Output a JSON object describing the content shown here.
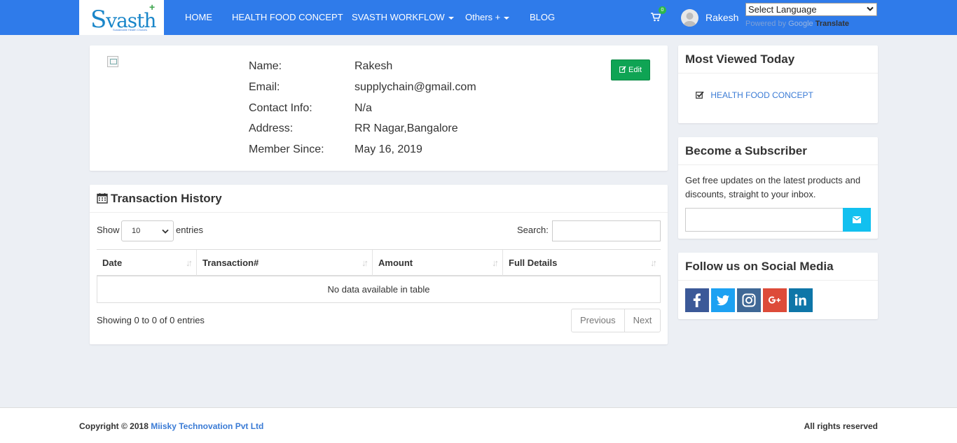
{
  "brand": {
    "logo_text": "vasth",
    "logo_initial": "S",
    "logo_plus": "+",
    "tagline": "Sustainable Health Choices"
  },
  "nav": {
    "items": [
      {
        "label": "HOME"
      },
      {
        "label": "HEALTH FOOD CONCEPT"
      },
      {
        "label": "SVASTH WORKFLOW"
      },
      {
        "label": "Others +"
      },
      {
        "label": "BLOG"
      }
    ],
    "cart_count": "0",
    "user_name": "Rakesh",
    "language_select": "Select Language",
    "powered_by": "Powered by",
    "google": "Google",
    "translate": "Translate"
  },
  "profile": {
    "edit_label": "Edit",
    "fields": [
      {
        "label": "Name:",
        "value": "Rakesh"
      },
      {
        "label": "Email:",
        "value": "supplychain@gmail.com"
      },
      {
        "label": "Contact Info:",
        "value": "N/a"
      },
      {
        "label": "Address:",
        "value": "RR Nagar,Bangalore"
      },
      {
        "label": "Member Since:",
        "value": "May 16, 2019"
      }
    ]
  },
  "transactions": {
    "title": "Transaction History",
    "show_label": "Show",
    "page_size": "10",
    "entries_label": "entries",
    "search_label": "Search:",
    "columns": [
      "Date",
      "Transaction#",
      "Amount",
      "Full Details"
    ],
    "empty_text": "No data available in table",
    "showing_text": "Showing 0 to 0 of 0 entries",
    "prev_label": "Previous",
    "next_label": "Next"
  },
  "sidebar": {
    "most_viewed_title": "Most Viewed Today",
    "most_viewed_link": "HEALTH FOOD CONCEPT",
    "subscriber_title": "Become a Subscriber",
    "subscriber_text": "Get free updates on the latest products and discounts, straight to your inbox.",
    "social_title": "Follow us on Social Media",
    "social": [
      {
        "icon": "facebook-icon",
        "color": "#3b5998"
      },
      {
        "icon": "twitter-icon",
        "color": "#1da1f2"
      },
      {
        "icon": "instagram-icon",
        "color": "#3f6896"
      },
      {
        "icon": "google-plus-icon",
        "color": "#dd4b39"
      },
      {
        "icon": "linkedin-icon",
        "color": "#0e76a8"
      }
    ]
  },
  "footer": {
    "copyright_prefix": "Copyright © 2018",
    "company": "Miisky Technovation Pvt Ltd",
    "rights": "All rights reserved"
  },
  "colors": {
    "navbar": "#2f7bea",
    "edit_button": "#0fa454",
    "subscribe_button": "#12c0ef",
    "link": "#3a7bd5"
  }
}
